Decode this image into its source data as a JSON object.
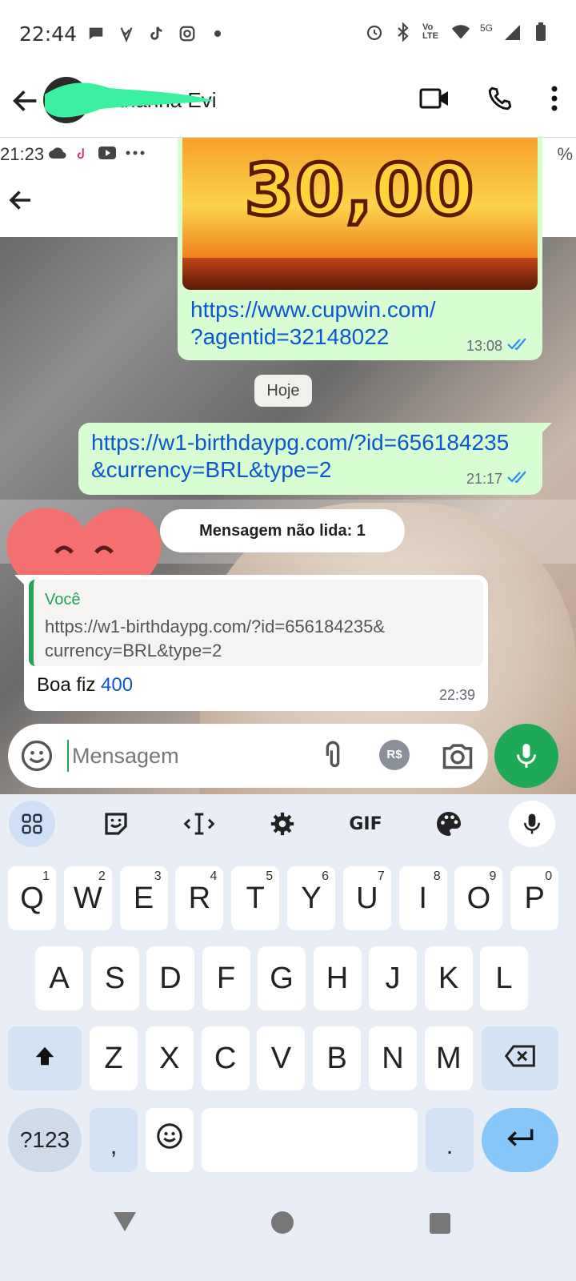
{
  "status_bar": {
    "time": "22:44",
    "left_icons": [
      "chat-bubble-icon",
      "vpn-check-icon",
      "tiktok-icon",
      "instagram-icon",
      "dot-icon"
    ],
    "right_icons": [
      "alarm-icon",
      "bluetooth-icon",
      "volte-icon",
      "wifi-icon",
      "signal-5g-icon",
      "battery-icon"
    ],
    "volte_label": "Vo LTE",
    "network_label": "5G"
  },
  "chat_header": {
    "contact_name": "...thanna Evi",
    "actions": [
      "video-call-icon",
      "voice-call-icon",
      "more-options-icon"
    ]
  },
  "wallpaper_screenshot": {
    "time": "21:23",
    "percent": "%",
    "icons": [
      "cloud-icon",
      "tiktok-icon",
      "youtube-icon",
      "more-dots-icon"
    ]
  },
  "messages": {
    "promo_image": {
      "amount": "30,00",
      "link_line1": "https://www.cupwin.com/",
      "link_line2": "?agentid=32148022",
      "time": "13:08",
      "status": "read"
    },
    "date_chip": "Hoje",
    "outgoing": {
      "link_line1": "https://w1-birthdaypg.com/?id=656184235",
      "link_line2": "&currency=BRL&type=2",
      "time": "21:17",
      "status": "read"
    },
    "unread_banner": "Mensagem não lida: 1",
    "incoming": {
      "quote_author": "Você",
      "quote_line1": "https://w1-birthdaypg.com/?id=656184235&",
      "quote_line2": "currency=BRL&type=2",
      "text": "Boa fiz",
      "number": "400",
      "time": "22:39"
    }
  },
  "composer": {
    "placeholder": "Mensagem",
    "payment_label": "R$"
  },
  "keyboard": {
    "toolbar_gif": "GIF",
    "row1": [
      {
        "label": "Q",
        "hint": "1"
      },
      {
        "label": "W",
        "hint": "2"
      },
      {
        "label": "E",
        "hint": "3"
      },
      {
        "label": "R",
        "hint": "4"
      },
      {
        "label": "T",
        "hint": "5"
      },
      {
        "label": "Y",
        "hint": "6"
      },
      {
        "label": "U",
        "hint": "7"
      },
      {
        "label": "I",
        "hint": "8"
      },
      {
        "label": "O",
        "hint": "9"
      },
      {
        "label": "P",
        "hint": "0"
      }
    ],
    "row2": [
      "A",
      "S",
      "D",
      "F",
      "G",
      "H",
      "J",
      "K",
      "L"
    ],
    "row3": [
      "Z",
      "X",
      "C",
      "V",
      "B",
      "N",
      "M"
    ],
    "mode_key": "?123",
    "comma_key": ",",
    "period_key": "."
  },
  "colors": {
    "accent_green": "#1fa855",
    "link_blue": "#0b57d0",
    "outgoing_bubble": "#d9fdd3",
    "read_ticks": "#2a8ef0"
  }
}
